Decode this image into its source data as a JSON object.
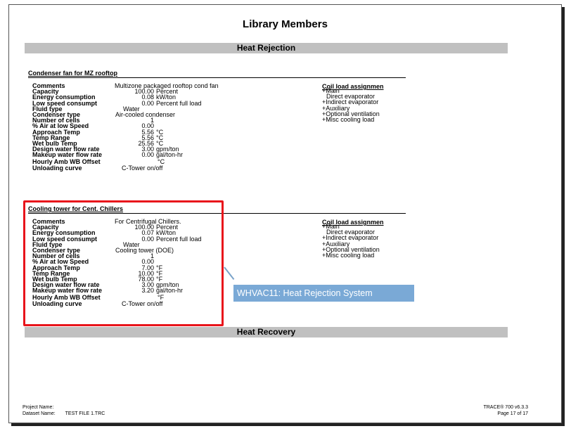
{
  "report": {
    "title": "Library Members",
    "section1": "Heat Rejection",
    "section2": "Heat Recovery"
  },
  "labels": [
    "Comments",
    "Capacity",
    "Energy consumption",
    "Low speed consumpt",
    "Fluid type",
    "Condenser type",
    "Number of cells",
    "% Air at low Speed",
    "Approach Temp",
    "Temp Range",
    "Wet bulb Temp",
    "Design water flow rate",
    "Makeup water flow rate",
    "Hourly Amb WB Offset",
    "Unloading curve"
  ],
  "block1": {
    "title": "Condenser fan for MZ rooftop",
    "comments": "Multizone packaged rooftop cond fan",
    "capacity": "100.00",
    "capacity_unit": "Percent",
    "energy": "0.08",
    "energy_unit": "kW/ton",
    "lowspeed": "0.00",
    "lowspeed_unit": "Percent full load",
    "fluid": "Water",
    "condenser": "Air-cooled condenser",
    "cells": "1",
    "air": "0.00",
    "approach": "5.56",
    "approach_unit": "°C",
    "range": "5.56",
    "range_unit": "°C",
    "wetbulb": "25.56",
    "wetbulb_unit": "°C",
    "design_flow": "3.00",
    "design_flow_unit": "gpm/ton",
    "makeup_flow": "0.00",
    "makeup_flow_unit": "gal/ton-hr",
    "offset_unit": "°C",
    "unloading": "C-Tower on/off"
  },
  "block2": {
    "title": "Cooling tower for Cent. Chillers",
    "comments": "For Centrifugal Chillers.",
    "capacity": "100.00",
    "capacity_unit": "Percent",
    "energy": "0.07",
    "energy_unit": "kW/ton",
    "lowspeed": "0.00",
    "lowspeed_unit": "Percent full load",
    "fluid": "Water",
    "condenser": "Cooling tower (DOE)",
    "cells": "1",
    "air": "0.00",
    "approach": "7.00",
    "approach_unit": "°F",
    "range": "10.00",
    "range_unit": "°F",
    "wetbulb": "78.00",
    "wetbulb_unit": "°F",
    "design_flow": "3.00",
    "design_flow_unit": "gpm/ton",
    "makeup_flow": "3.20",
    "makeup_flow_unit": "gal/ton-hr",
    "offset_unit": "°F",
    "unloading": "C-Tower on/off"
  },
  "coil": {
    "heading": "Coil load assignmen",
    "items": [
      "+Main",
      "Direct evaporator",
      "+Indirect evaporator",
      "+Auxiliary",
      "+Optional ventilation",
      "+Misc cooling load"
    ]
  },
  "callout": "WHVAC11: Heat Rejection System",
  "footer": {
    "project_label": "Project Name:",
    "dataset_label": "Dataset Name:",
    "dataset_value": "TEST FILE 1.TRC",
    "product": "TRACE® 700 v6.3.3",
    "page": "Page 17 of 17"
  },
  "colors": {
    "highlight": "#e8141b",
    "callout": "#7aa9d6",
    "section_bar": "#c0c0c0"
  }
}
